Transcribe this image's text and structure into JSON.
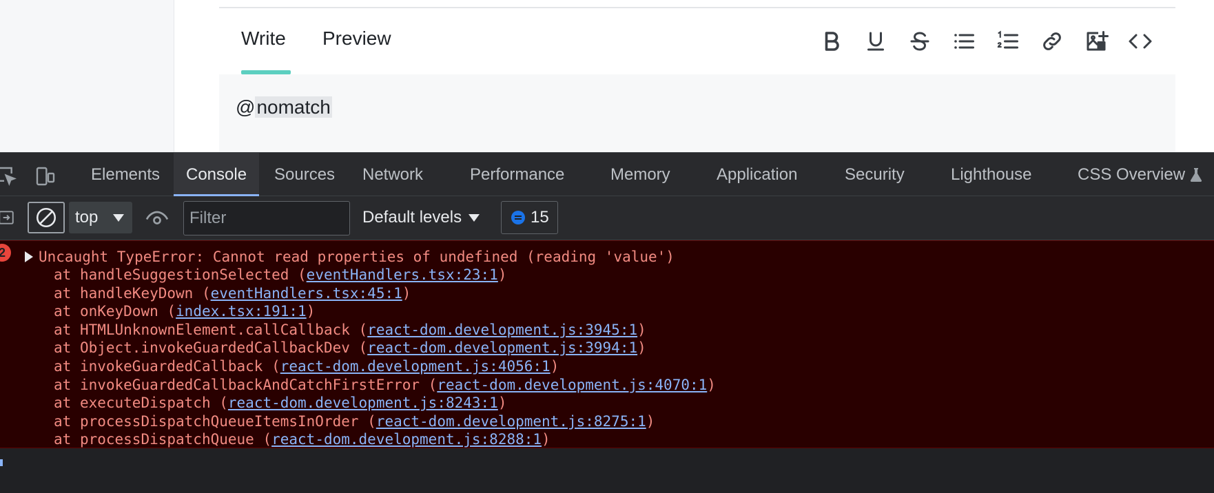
{
  "editor": {
    "tabs": [
      {
        "label": "Write"
      },
      {
        "label": "Preview"
      }
    ],
    "toolbar_icons": [
      "bold-icon",
      "underline-icon",
      "strikethrough-icon",
      "bullet-list-icon",
      "numbered-list-icon",
      "link-icon",
      "image-icon",
      "code-icon"
    ],
    "content_prefix": "@",
    "content_mention": "nomatch"
  },
  "devtools": {
    "tabs": [
      {
        "label": "Elements"
      },
      {
        "label": "Console"
      },
      {
        "label": "Sources"
      },
      {
        "label": "Network"
      },
      {
        "label": "Performance"
      },
      {
        "label": "Memory"
      },
      {
        "label": "Application"
      },
      {
        "label": "Security"
      },
      {
        "label": "Lighthouse"
      },
      {
        "label": "CSS Overview"
      }
    ],
    "active_tab": "Console",
    "toolbar": {
      "context": "top",
      "filter_placeholder": "Filter",
      "levels": "Default levels",
      "message_count": "15"
    },
    "error": {
      "count": "2",
      "message": "Uncaught TypeError: Cannot read properties of undefined (reading 'value')",
      "stack": [
        {
          "fn": "handleSuggestionSelected",
          "src": "eventHandlers.tsx:23:1"
        },
        {
          "fn": "handleKeyDown",
          "src": "eventHandlers.tsx:45:1"
        },
        {
          "fn": "onKeyDown",
          "src": "index.tsx:191:1"
        },
        {
          "fn": "HTMLUnknownElement.callCallback",
          "src": "react-dom.development.js:3945:1"
        },
        {
          "fn": "Object.invokeGuardedCallbackDev",
          "src": "react-dom.development.js:3994:1"
        },
        {
          "fn": "invokeGuardedCallback",
          "src": "react-dom.development.js:4056:1"
        },
        {
          "fn": "invokeGuardedCallbackAndCatchFirstError",
          "src": "react-dom.development.js:4070:1"
        },
        {
          "fn": "executeDispatch",
          "src": "react-dom.development.js:8243:1"
        },
        {
          "fn": "processDispatchQueueItemsInOrder",
          "src": "react-dom.development.js:8275:1"
        },
        {
          "fn": "processDispatchQueue",
          "src": "react-dom.development.js:8288:1"
        }
      ]
    },
    "colors": {
      "error_bg": "#290000",
      "error_text": "#f28b82",
      "link": "#8ab4f8",
      "accent": "#5ccfc0"
    }
  }
}
